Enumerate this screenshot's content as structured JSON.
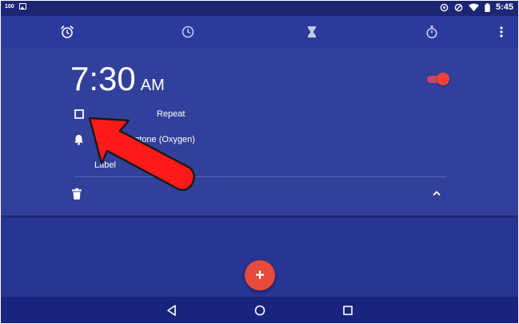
{
  "status_bar": {
    "battery_percent_label": "100",
    "time": "5:45",
    "icons": [
      "image-notification-icon",
      "alarm-set-icon",
      "do-not-disturb-icon",
      "wifi-icon",
      "battery-icon"
    ]
  },
  "toolbar": {
    "tabs": [
      {
        "name": "alarm-icon",
        "active": true
      },
      {
        "name": "clock-icon",
        "active": false
      },
      {
        "name": "timer-icon",
        "active": false
      },
      {
        "name": "stopwatch-icon",
        "active": false
      }
    ],
    "overflow_icon": "more-vert-icon"
  },
  "alarm": {
    "time": "7:30",
    "ampm": "AM",
    "enabled": true,
    "repeat_label": "Repeat",
    "repeat_checked": false,
    "ringtone_label": "Default ringtone (Oxygen)",
    "label_placeholder": "Label",
    "collapse_icon": "chevron-up-icon",
    "delete_icon": "trash-icon"
  },
  "fab": {
    "label": "+"
  },
  "nav": {
    "icons": [
      "back-icon",
      "home-icon",
      "recents-icon"
    ]
  },
  "colors": {
    "background": "#283593",
    "toolbar": "#2c3a9e",
    "card": "#33409b",
    "accent": "#f44336",
    "fab": "#e84a3c",
    "annotation_arrow": "#ff1a1a"
  }
}
